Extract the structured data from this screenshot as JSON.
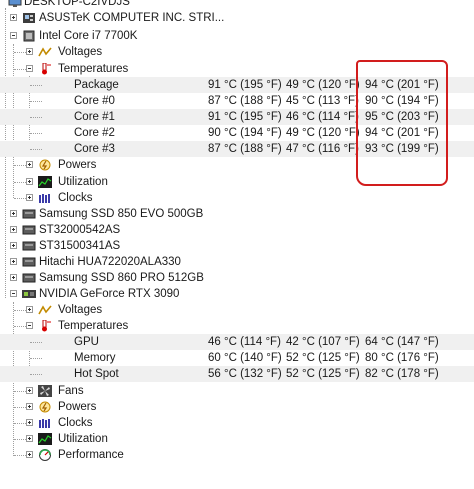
{
  "tree": {
    "root": "DESKTOP-C2IVDJS",
    "motherboard": "ASUSTeK COMPUTER INC. STRI...",
    "cpu": {
      "name": "Intel Core i7 7700K",
      "voltages": "Voltages",
      "temperatures": "Temperatures",
      "sensors": [
        {
          "name": "Package",
          "value": "91 °C  (195 °F)",
          "min": "49 °C  (120 °F)",
          "max": "94 °C  (201 °F)"
        },
        {
          "name": "Core #0",
          "value": "87 °C  (188 °F)",
          "min": "45 °C  (113 °F)",
          "max": "90 °C  (194 °F)"
        },
        {
          "name": "Core #1",
          "value": "91 °C  (195 °F)",
          "min": "46 °C  (114 °F)",
          "max": "95 °C  (203 °F)"
        },
        {
          "name": "Core #2",
          "value": "90 °C  (194 °F)",
          "min": "49 °C  (120 °F)",
          "max": "94 °C  (201 °F)"
        },
        {
          "name": "Core #3",
          "value": "87 °C  (188 °F)",
          "min": "47 °C  (116 °F)",
          "max": "93 °C  (199 °F)"
        }
      ],
      "powers": "Powers",
      "utilization": "Utilization",
      "clocks": "Clocks"
    },
    "disks": [
      "Samsung SSD 850 EVO 500GB",
      "ST32000542AS",
      "ST31500341AS",
      "Hitachi HUA722020ALA330",
      "Samsung SSD 860 PRO 512GB"
    ],
    "gpu": {
      "name": "NVIDIA GeForce RTX 3090",
      "voltages": "Voltages",
      "temperatures": "Temperatures",
      "sensors": [
        {
          "name": "GPU",
          "value": "46 °C  (114 °F)",
          "min": "42 °C  (107 °F)",
          "max": "64 °C  (147 °F)"
        },
        {
          "name": "Memory",
          "value": "60 °C  (140 °F)",
          "min": "52 °C  (125 °F)",
          "max": "80 °C  (176 °F)"
        },
        {
          "name": "Hot Spot",
          "value": "56 °C  (132 °F)",
          "min": "52 °C  (125 °F)",
          "max": "82 °C  (178 °F)"
        }
      ],
      "fans": "Fans",
      "powers": "Powers",
      "clocks": "Clocks",
      "utilization": "Utilization",
      "performance": "Performance"
    }
  },
  "colors": {
    "annotation": "#d21d1d",
    "row_alt": "#f0f0f0"
  }
}
